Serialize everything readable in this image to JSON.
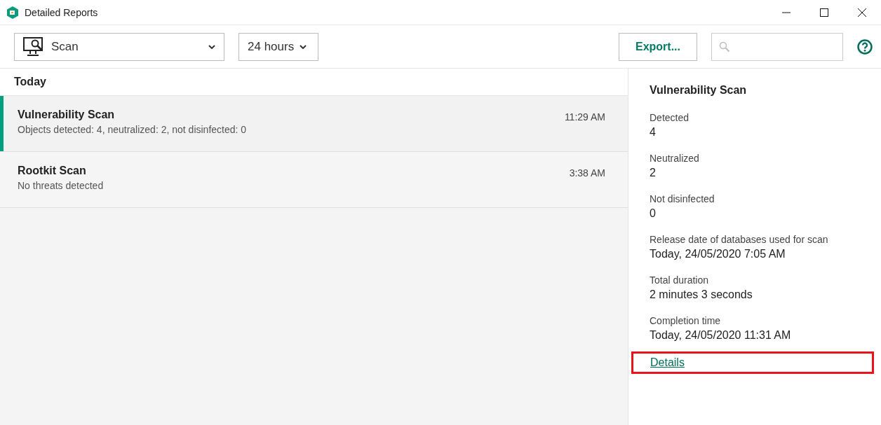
{
  "window": {
    "title": "Detailed Reports"
  },
  "toolbar": {
    "component": "Scan",
    "period": "24 hours",
    "export": "Export..."
  },
  "groups": [
    {
      "heading": "Today",
      "items": [
        {
          "title": "Vulnerability Scan",
          "summary": "Objects detected: 4, neutralized: 2, not disinfected: 0",
          "time": "11:29 AM",
          "selected": true
        },
        {
          "title": "Rootkit Scan",
          "summary": "No threats detected",
          "time": "3:38 AM",
          "selected": false
        }
      ]
    }
  ],
  "details": {
    "title": "Vulnerability Scan",
    "fields": [
      {
        "label": "Detected",
        "value": "4"
      },
      {
        "label": "Neutralized",
        "value": "2"
      },
      {
        "label": "Not disinfected",
        "value": "0"
      },
      {
        "label": "Release date of databases used for scan",
        "value": "Today, 24/05/2020 7:05 AM"
      },
      {
        "label": "Total duration",
        "value": "2 minutes 3 seconds"
      },
      {
        "label": "Completion time",
        "value": "Today, 24/05/2020 11:31 AM"
      }
    ],
    "link": {
      "label": "Details",
      "highlighted": true
    }
  }
}
